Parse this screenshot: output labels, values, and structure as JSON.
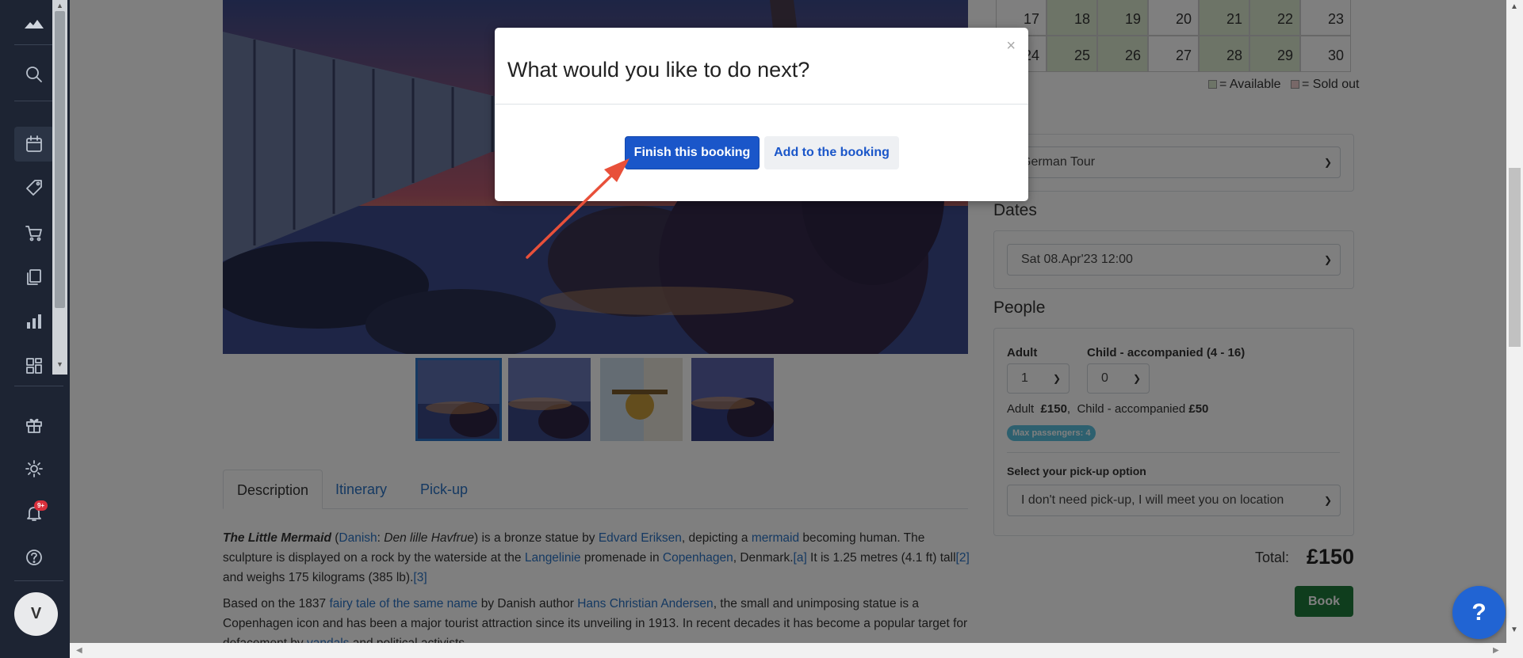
{
  "sidebar": {
    "avatar_initial": "V",
    "notifications_badge": "9+",
    "icons": [
      "logo-mountain-icon",
      "search-icon",
      "calendar-icon",
      "tag-icon",
      "cart-icon",
      "copy-icon",
      "bar-chart-icon",
      "dashboard-icon",
      "gift-icon",
      "gear-icon",
      "bell-icon",
      "help-circle-icon"
    ]
  },
  "calendar": {
    "rows": [
      [
        {
          "d": "17",
          "status": "plain"
        },
        {
          "d": "18",
          "status": "available"
        },
        {
          "d": "19",
          "status": "available"
        },
        {
          "d": "20",
          "status": "plain"
        },
        {
          "d": "21",
          "status": "available"
        },
        {
          "d": "22",
          "status": "available"
        },
        {
          "d": "23",
          "status": "plain"
        }
      ],
      [
        {
          "d": "24",
          "status": "plain"
        },
        {
          "d": "25",
          "status": "available"
        },
        {
          "d": "26",
          "status": "available"
        },
        {
          "d": "27",
          "status": "plain"
        },
        {
          "d": "28",
          "status": "available"
        },
        {
          "d": "29",
          "status": "available"
        },
        {
          "d": "30",
          "status": "plain"
        }
      ]
    ],
    "legend_available": "= Available",
    "legend_sold_out": "= Sold out",
    "colors": {
      "available": "#dbe9cf",
      "sold_out": "#f0d0d0"
    }
  },
  "booking": {
    "tour_select": "German Tour",
    "dates_heading": "Dates",
    "date_select": "Sat 08.Apr'23  12:00",
    "people_heading": "People",
    "adult_label": "Adult",
    "adult_value": "1",
    "child_label": "Child - accompanied (4 - 16)",
    "child_value": "0",
    "price_adult_label": "Adult",
    "price_adult": "£150",
    "price_child_label": "Child - accompanied",
    "price_child": "£50",
    "max_passengers": "Max passengers: 4",
    "pickup_label": "Select your pick-up option",
    "pickup_select": "I don't need pick-up, I will meet you on location",
    "total_label": "Total:",
    "total_value": "£150",
    "book_label": "Book"
  },
  "tabs": [
    "Description",
    "Itinerary",
    "Pick-up"
  ],
  "description": {
    "p1": [
      {
        "t": "The Little Mermaid",
        "s": "bi"
      },
      {
        "t": " (",
        "s": ""
      },
      {
        "t": "Danish",
        "s": "lk"
      },
      {
        "t": ": ",
        "s": ""
      },
      {
        "t": "Den lille Havfrue",
        "s": "i"
      },
      {
        "t": ") is a bronze statue by ",
        "s": ""
      },
      {
        "t": "Edvard Eriksen",
        "s": "lk"
      },
      {
        "t": ", depicting a ",
        "s": ""
      },
      {
        "t": "mermaid",
        "s": "lk"
      },
      {
        "t": " becoming human. The sculpture is displayed on a rock by the waterside at the ",
        "s": ""
      },
      {
        "t": "Langelinie",
        "s": "lk"
      },
      {
        "t": " promenade in ",
        "s": ""
      },
      {
        "t": "Copenhagen",
        "s": "lk"
      },
      {
        "t": ", Denmark.",
        "s": ""
      },
      {
        "t": "[a]",
        "s": "lk"
      },
      {
        "t": " It is 1.25 metres (4.1 ft) tall",
        "s": ""
      },
      {
        "t": "[2]",
        "s": "lk"
      },
      {
        "t": " and weighs 175 kilograms (385 lb).",
        "s": ""
      },
      {
        "t": "[3]",
        "s": "lk"
      }
    ],
    "p2": [
      {
        "t": "Based on the 1837 ",
        "s": ""
      },
      {
        "t": "fairy tale of the same name",
        "s": "lk"
      },
      {
        "t": " by Danish author ",
        "s": ""
      },
      {
        "t": "Hans Christian Andersen",
        "s": "lk"
      },
      {
        "t": ", the small and unimposing statue is a Copenhagen icon and has been a major tourist attraction since its unveiling in 1913. In recent decades it has become a popular target for defacement by ",
        "s": ""
      },
      {
        "t": "vandals",
        "s": "lk"
      },
      {
        "t": " and political activists.",
        "s": ""
      }
    ]
  },
  "modal": {
    "title": "What would you like to do next?",
    "close": "×",
    "primary_button": "Finish this booking",
    "secondary_button": "Add to the booking"
  },
  "help_button": "?"
}
